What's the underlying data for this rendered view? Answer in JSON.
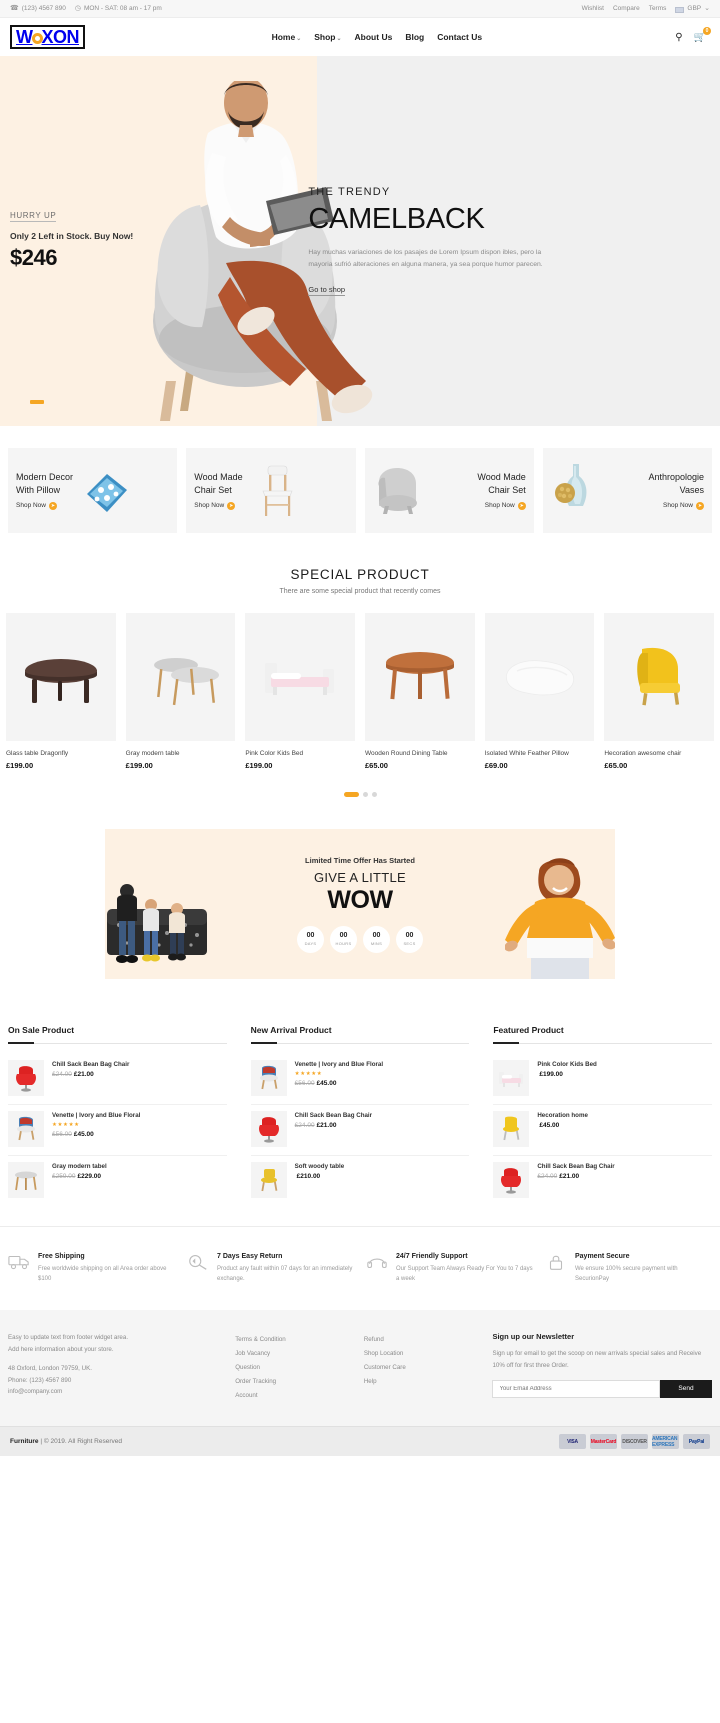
{
  "topbar": {
    "phone": "(123) 4567 890",
    "hours": "MON - SAT: 08 am - 17 pm",
    "phone_icon": "phone-icon",
    "clock_icon": "clock-icon",
    "links": [
      {
        "label": "Wishlist"
      },
      {
        "label": "Compare"
      },
      {
        "label": "Terms"
      }
    ],
    "currency": "GBP",
    "currency_caret": "⌄"
  },
  "header": {
    "logo_left": "W",
    "logo_right": "XON",
    "nav": [
      {
        "label": "Home",
        "caret": "⌄"
      },
      {
        "label": "Shop",
        "caret": "⌄"
      },
      {
        "label": "About Us",
        "caret": ""
      },
      {
        "label": "Blog",
        "caret": ""
      },
      {
        "label": "Contact Us",
        "caret": ""
      }
    ],
    "search_icon": "search-icon",
    "cart_icon": "cart-icon",
    "cart_count": "0"
  },
  "hero": {
    "hurry": "HURRY UP",
    "stock": "Only 2 Left in Stock. Buy Now!",
    "price": "$246",
    "eyebrow": "THE TRENDY",
    "title": "CAMELBACK",
    "description": "Hay muchas variaciones de los pasajes de Lorem Ipsum dispon ibles, pero la mayoria sufrió alteraciones en alguna manera, ya sea porque humor parecen.",
    "cta": "Go to shop"
  },
  "categories": [
    {
      "title": "Modern Decor\nWith Pillow",
      "line1": "Modern Decor",
      "line2": "With Pillow",
      "cta": "Shop Now",
      "align": "left",
      "image": "pillow-image"
    },
    {
      "line1": "Wood Made",
      "line2": "Chair Set",
      "cta": "Shop Now",
      "align": "left",
      "image": "wooden-chair-image"
    },
    {
      "line1": "Wood Made",
      "line2": "Chair Set",
      "cta": "Shop Now",
      "align": "right",
      "image": "gray-armchair-image"
    },
    {
      "line1": "Anthropologie",
      "line2": "Vases",
      "cta": "Shop Now",
      "align": "right",
      "image": "vase-image"
    }
  ],
  "special": {
    "title": "SPECIAL PRODUCT",
    "subtitle": "There are some special product that recently comes",
    "products": [
      {
        "name": "Glass table Dragonfly",
        "price": "£199.00",
        "image": "dark-coffee-table-image"
      },
      {
        "name": "Gray modern table",
        "price": "£199.00",
        "image": "gray-nesting-tables-image"
      },
      {
        "name": "Pink Color Kids Bed",
        "price": "£199.00",
        "image": "pink-kids-bed-image"
      },
      {
        "name": "Wooden Round Dining Table",
        "price": "£65.00",
        "image": "wooden-round-table-image"
      },
      {
        "name": "Isolated White Feather Pillow",
        "price": "£69.00",
        "image": "white-pillow-image"
      },
      {
        "name": "Hecoration awesome chair",
        "price": "£65.00",
        "image": "yellow-wing-chair-image"
      }
    ],
    "dots": [
      "active",
      "",
      ""
    ]
  },
  "wow": {
    "eyebrow": "Limited Time Offer Has Started",
    "line1": "GIVE A LITTLE",
    "line2": "WOW",
    "counters": [
      {
        "value": "00",
        "label": "DAYS"
      },
      {
        "value": "00",
        "label": "HOURS"
      },
      {
        "value": "00",
        "label": "MINS"
      },
      {
        "value": "00",
        "label": "SECS"
      }
    ]
  },
  "columns": [
    {
      "heading": "On Sale Product",
      "items": [
        {
          "name": "Chill Sack Bean Bag Chair",
          "stars": "",
          "old": "£24.00",
          "price": "£21.00",
          "image": "red-bean-bag-chair-image"
        },
        {
          "name": "Venette | Ivory and Blue Floral",
          "stars": "★★★★★",
          "old": "£56.00",
          "price": "£45.00",
          "image": "floral-chair-image"
        },
        {
          "name": "Gray modern tabel",
          "stars": "",
          "old": "£259.00",
          "price": "£229.00",
          "image": "gray-table-image"
        }
      ]
    },
    {
      "heading": "New Arrival Product",
      "items": [
        {
          "name": "Venette | Ivory and Blue Floral",
          "stars": "★★★★★",
          "old": "£56.00",
          "price": "£45.00",
          "image": "floral-chair-image"
        },
        {
          "name": "Chill Sack Bean Bag Chair",
          "stars": "",
          "old": "£24.00",
          "price": "£21.00",
          "image": "red-bean-bag-chair-image"
        },
        {
          "name": "Soft woody table",
          "stars": "",
          "old": "",
          "price": "£210.00",
          "image": "yellow-wood-chair-image"
        }
      ]
    },
    {
      "heading": "Featured Product",
      "items": [
        {
          "name": "Pink Color Kids Bed",
          "stars": "",
          "old": "",
          "price": "£199.00",
          "image": "pink-kids-bed-image"
        },
        {
          "name": "Hecoration home",
          "stars": "",
          "old": "",
          "price": "£45.00",
          "image": "yellow-chair-image"
        },
        {
          "name": "Chill Sack Bean Bag Chair",
          "stars": "",
          "old": "£24.00",
          "price": "£21.00",
          "image": "red-bean-bag-chair-image"
        }
      ]
    }
  ],
  "services": [
    {
      "icon": "truck-icon",
      "title": "Free Shipping",
      "desc": "Free worldwide shipping on all Area order above $100"
    },
    {
      "icon": "return-icon",
      "title": "7 Days Easy Return",
      "desc": "Product any fault within 07 days for an immediately exchange."
    },
    {
      "icon": "support-icon",
      "title": "24/7 Friendly Support",
      "desc": "Our Support Team Always Ready For You to 7 days a week"
    },
    {
      "icon": "lock-icon",
      "title": "Payment Secure",
      "desc": "We ensure 100% secure payment with SecurionPay"
    }
  ],
  "footer": {
    "about": [
      "Easy to update text from footer widget area.",
      "Add here information about your store."
    ],
    "address": "48 Oxford, London 79759, UK.",
    "phone": "Phone: (123) 4567 890",
    "email": "info@company.com",
    "links_col1": [
      {
        "label": "Terms & Condition"
      },
      {
        "label": "Job Vacancy"
      },
      {
        "label": "Question"
      },
      {
        "label": "Order Tracking"
      },
      {
        "label": "Account"
      }
    ],
    "links_col2": [
      {
        "label": "Refund"
      },
      {
        "label": "Shop Location"
      },
      {
        "label": "Customer Care"
      },
      {
        "label": "Help"
      }
    ],
    "newsletter_title": "Sign up our Newsletter",
    "newsletter_desc": "Sign up for email to get the scoop on new arrivals special sales and Receive 10% off for first three Order.",
    "newsletter_placeholder": "Your Email Address",
    "newsletter_button": "Send"
  },
  "bottombar": {
    "brand": "Furniture",
    "separator": "|",
    "copyright": "© 2019. All Right Reserved",
    "payments": [
      {
        "label": "VISA",
        "color": "#1a1f71",
        "bg": "#c9ccd4"
      },
      {
        "label": "MasterCard",
        "color": "#eb001b",
        "bg": "#c9ccd4"
      },
      {
        "label": "DISCOVER",
        "color": "#555",
        "bg": "#c9ccd4"
      },
      {
        "label": "AMERICAN EXPRESS",
        "color": "#2e77bc",
        "bg": "#c9ccd4"
      },
      {
        "label": "PayPal",
        "color": "#003087",
        "bg": "#c9ccd4"
      }
    ]
  },
  "colors": {
    "accent": "#f5a623",
    "hero_left_bg": "#fdf1e3",
    "hero_right_bg": "#f0f0f0",
    "card_bg": "#f5f5f5",
    "footer_bg": "#f5f5f5"
  }
}
